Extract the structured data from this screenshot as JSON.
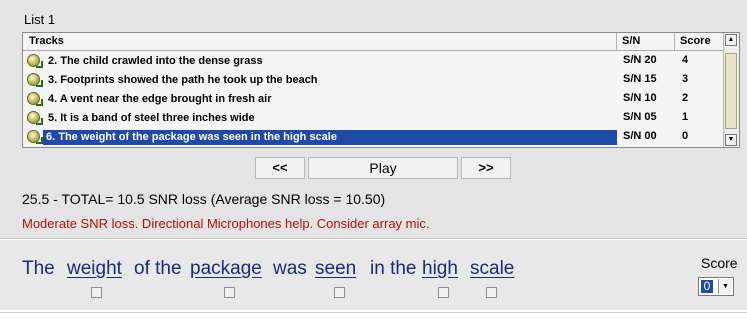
{
  "list": {
    "caption": "List 1",
    "columns": {
      "tracks": "Tracks",
      "sn": "S/N",
      "score": "Score"
    },
    "rows": [
      {
        "title": "2. The child crawled into the dense grass",
        "sn": "S/N 20",
        "score": "4",
        "icon": "audio-track-icon"
      },
      {
        "title": "3. Footprints showed the path he took up the beach",
        "sn": "S/N 15",
        "score": "3",
        "icon": "audio-track-icon"
      },
      {
        "title": "4. A vent near the edge brought in fresh air",
        "sn": "S/N 10",
        "score": "2",
        "icon": "audio-track-icon"
      },
      {
        "title": "5. It is a band of steel three inches wide",
        "sn": "S/N 05",
        "score": "1",
        "icon": "audio-track-icon"
      },
      {
        "title": "6. The weight of the package was seen in the high scale",
        "sn": "S/N 00",
        "score": "0",
        "icon": "audio-track-icon",
        "selected": true
      }
    ],
    "scroll_up_glyph": "▲",
    "scroll_down_glyph": "▼"
  },
  "controls": {
    "prev_label": "<<",
    "play_label": "Play",
    "next_label": ">>"
  },
  "result": {
    "total_text": "25.5 - TOTAL= 10.5 SNR loss (Average SNR loss = 10.50)",
    "advice_text": "Moderate SNR loss. Directional Microphones help. Consider array mic."
  },
  "sentence": {
    "words": [
      {
        "text": "The",
        "key": false
      },
      {
        "text": "weight",
        "key": true
      },
      {
        "text": "of the",
        "key": false
      },
      {
        "text": "package",
        "key": true
      },
      {
        "text": "was",
        "key": false
      },
      {
        "text": "seen",
        "key": true
      },
      {
        "text": "in the",
        "key": false
      },
      {
        "text": "high",
        "key": true
      },
      {
        "text": "scale",
        "key": true
      }
    ],
    "keyword_checked": [
      false,
      false,
      false,
      false,
      false
    ]
  },
  "score": {
    "label": "Score",
    "value": "0",
    "arrow_glyph": "▼"
  },
  "colors": {
    "selection": "#1f4aa8",
    "advice": "#b01010",
    "sentence": "#1a2a7a"
  }
}
